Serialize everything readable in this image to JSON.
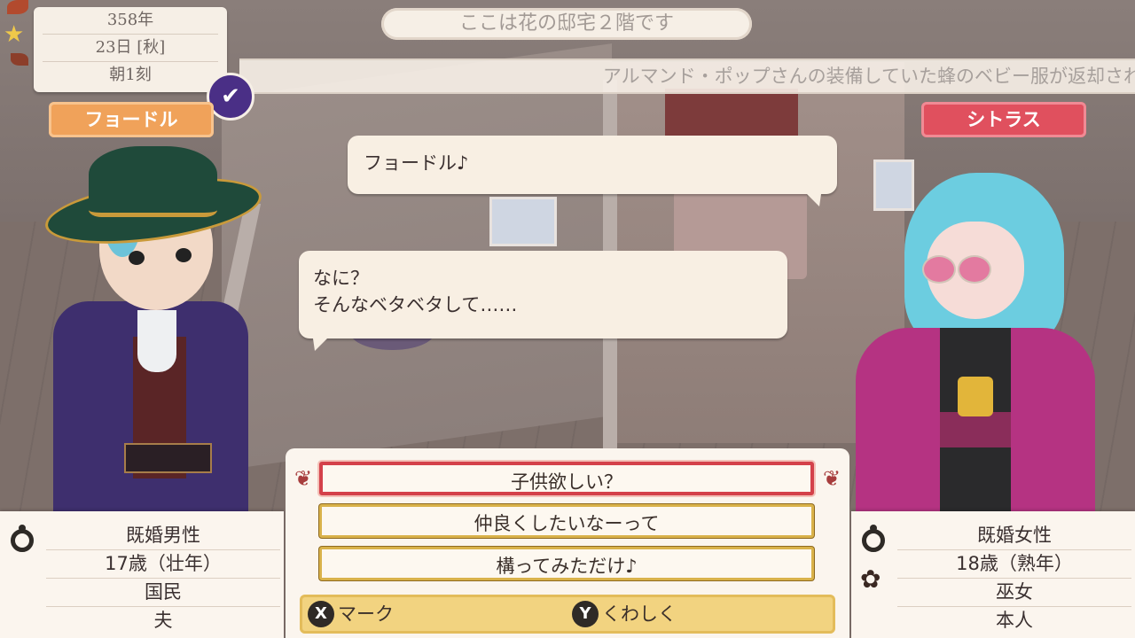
{
  "date": {
    "year": "358年",
    "day": "23日 [秋]",
    "time": "朝1刻"
  },
  "location": "ここは花の邸宅２階です",
  "ticker": "アルマンド・ポップさんの装備していた蜂のベビー服が返却され",
  "left_character": {
    "name": "フョードル",
    "info": [
      "既婚男性",
      "17歳（壮年）",
      "国民",
      "夫"
    ]
  },
  "right_character": {
    "name": "シトラス",
    "info": [
      "既婚女性",
      "18歳（熟年）",
      "巫女",
      "本人"
    ]
  },
  "dialogue": {
    "bubble1": "フョードル♪",
    "bubble2_line1": "なに？",
    "bubble2_line2": "そんなベタベタして……"
  },
  "choices": [
    {
      "label": "子供欲しい？",
      "selected": true
    },
    {
      "label": "仲良くしたいなーって",
      "selected": false
    },
    {
      "label": "構ってみただけ♪",
      "selected": false
    }
  ],
  "help": {
    "x_button": "X",
    "x_label": "マーク",
    "y_button": "Y",
    "y_label": "くわしく"
  },
  "icons": {
    "check": "check-icon",
    "ring": "ring-icon",
    "flower": "flower-icon",
    "ornament": "ornament-icon"
  },
  "colors": {
    "left_nameplate": "#f0a25a",
    "right_nameplate": "#e0505e",
    "selected_choice_border": "#d4414a",
    "choice_border": "#d9b24a",
    "check_badge": "#4a2f86"
  }
}
